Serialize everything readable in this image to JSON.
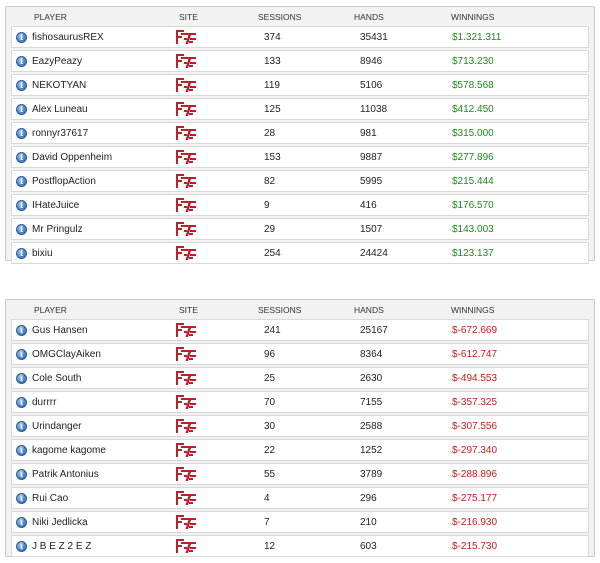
{
  "columns": {
    "player": "PLAYER",
    "site": "SITE",
    "sessions": "SESSIONS",
    "hands": "HANDS",
    "winnings": "WINNINGS"
  },
  "colors": {
    "positive": "#1f8a1f",
    "negative": "#cc1a1a",
    "site_logo": "#b8202e"
  },
  "winners": [
    {
      "player": "fishosaurusREX",
      "sessions": "374",
      "hands": "35431",
      "winnings": "$1.321.311"
    },
    {
      "player": "EazyPeazy",
      "sessions": "133",
      "hands": "8946",
      "winnings": "$713.230"
    },
    {
      "player": "NEKOTYAN",
      "sessions": "119",
      "hands": "5106",
      "winnings": "$578.568"
    },
    {
      "player": "Alex Luneau",
      "sessions": "125",
      "hands": "11038",
      "winnings": "$412.450"
    },
    {
      "player": "ronnyr37617",
      "sessions": "28",
      "hands": "981",
      "winnings": "$315.000"
    },
    {
      "player": "David Oppenheim",
      "sessions": "153",
      "hands": "9887",
      "winnings": "$277.896"
    },
    {
      "player": "PostflopAction",
      "sessions": "82",
      "hands": "5995",
      "winnings": "$215.444"
    },
    {
      "player": "IHateJuice",
      "sessions": "9",
      "hands": "416",
      "winnings": "$176.570"
    },
    {
      "player": "Mr Pringulz",
      "sessions": "29",
      "hands": "1507",
      "winnings": "$143.003"
    },
    {
      "player": "bixiu",
      "sessions": "254",
      "hands": "24424",
      "winnings": "$123.137"
    }
  ],
  "losers": [
    {
      "player": "Gus Hansen",
      "sessions": "241",
      "hands": "25167",
      "winnings": "$-672.669"
    },
    {
      "player": "OMGClayAiken",
      "sessions": "96",
      "hands": "8364",
      "winnings": "$-612.747"
    },
    {
      "player": "Cole South",
      "sessions": "25",
      "hands": "2630",
      "winnings": "$-494.553"
    },
    {
      "player": "durrrr",
      "sessions": "70",
      "hands": "7155",
      "winnings": "$-357.325"
    },
    {
      "player": "Urindanger",
      "sessions": "30",
      "hands": "2588",
      "winnings": "$-307.556"
    },
    {
      "player": "kagome kagome",
      "sessions": "22",
      "hands": "1252",
      "winnings": "$-297.340"
    },
    {
      "player": "Patrik Antonius",
      "sessions": "55",
      "hands": "3789",
      "winnings": "$-288.896"
    },
    {
      "player": "Rui Cao",
      "sessions": "4",
      "hands": "296",
      "winnings": "$-275.177"
    },
    {
      "player": "Niki Jedlicka",
      "sessions": "7",
      "hands": "210",
      "winnings": "$-216.930"
    },
    {
      "player": "J B E Z 2 E Z",
      "sessions": "12",
      "hands": "603",
      "winnings": "$-215.730"
    }
  ]
}
